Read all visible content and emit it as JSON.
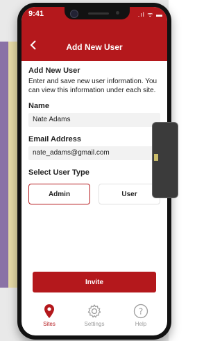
{
  "status_bar": {
    "time": "9:41",
    "icons": ".ıl ᯤ ▬"
  },
  "navbar": {
    "title": "Add New User",
    "back_icon": "chevron-left-icon"
  },
  "form": {
    "heading": "Add New User",
    "description": "Enter and save new user information. You can view this information under each site.",
    "name_label": "Name",
    "name_value": "Nate Adams",
    "email_label": "Email Address",
    "email_value": "nate_adams@gmail.com",
    "type_label": "Select User Type",
    "types": [
      {
        "label": "Admin",
        "selected": true
      },
      {
        "label": "User",
        "selected": false
      }
    ],
    "invite_label": "Invite"
  },
  "tabbar": [
    {
      "label": "Sites",
      "icon": "map-pin-icon",
      "active": true
    },
    {
      "label": "Settings",
      "icon": "gear-icon",
      "active": false
    },
    {
      "label": "Help",
      "icon": "question-circle-icon",
      "active": false
    }
  ],
  "colors": {
    "accent": "#b4181c",
    "field_bg": "#f2f2f2",
    "inactive": "#999999"
  }
}
